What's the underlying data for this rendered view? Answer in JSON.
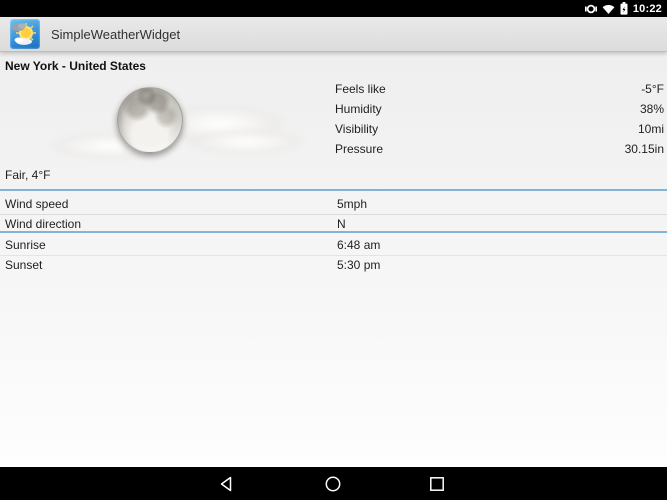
{
  "status_bar": {
    "time": "10:22",
    "icons": [
      "vibrate-icon",
      "wifi-icon",
      "battery-charging-icon"
    ]
  },
  "app_bar": {
    "title": "SimpleWeatherWidget",
    "icon": "sun-clouds-app-icon"
  },
  "weather": {
    "location": "New York - United States",
    "condition": "Fair, 4°F",
    "image": "full-moon-with-clouds",
    "stats": [
      {
        "label": "Feels like",
        "value": "-5°F"
      },
      {
        "label": "Humidity",
        "value": "38%"
      },
      {
        "label": "Visibility",
        "value": "10mi"
      },
      {
        "label": "Pressure",
        "value": "30.15in"
      }
    ],
    "wind": [
      {
        "label": "Wind speed",
        "value": "5mph"
      },
      {
        "label": "Wind direction",
        "value": "N"
      }
    ],
    "sun": [
      {
        "label": "Sunrise",
        "value": "6:48 am"
      },
      {
        "label": "Sunset",
        "value": "5:30 pm"
      }
    ]
  },
  "nav_bar": {
    "back": "back",
    "home": "home",
    "recents": "recents"
  },
  "colors": {
    "divider_blue": "#84b3d8",
    "status_bar_bg": "#000000",
    "app_bar_bg": "#e2e2e2",
    "text": "#1f1f1f"
  }
}
